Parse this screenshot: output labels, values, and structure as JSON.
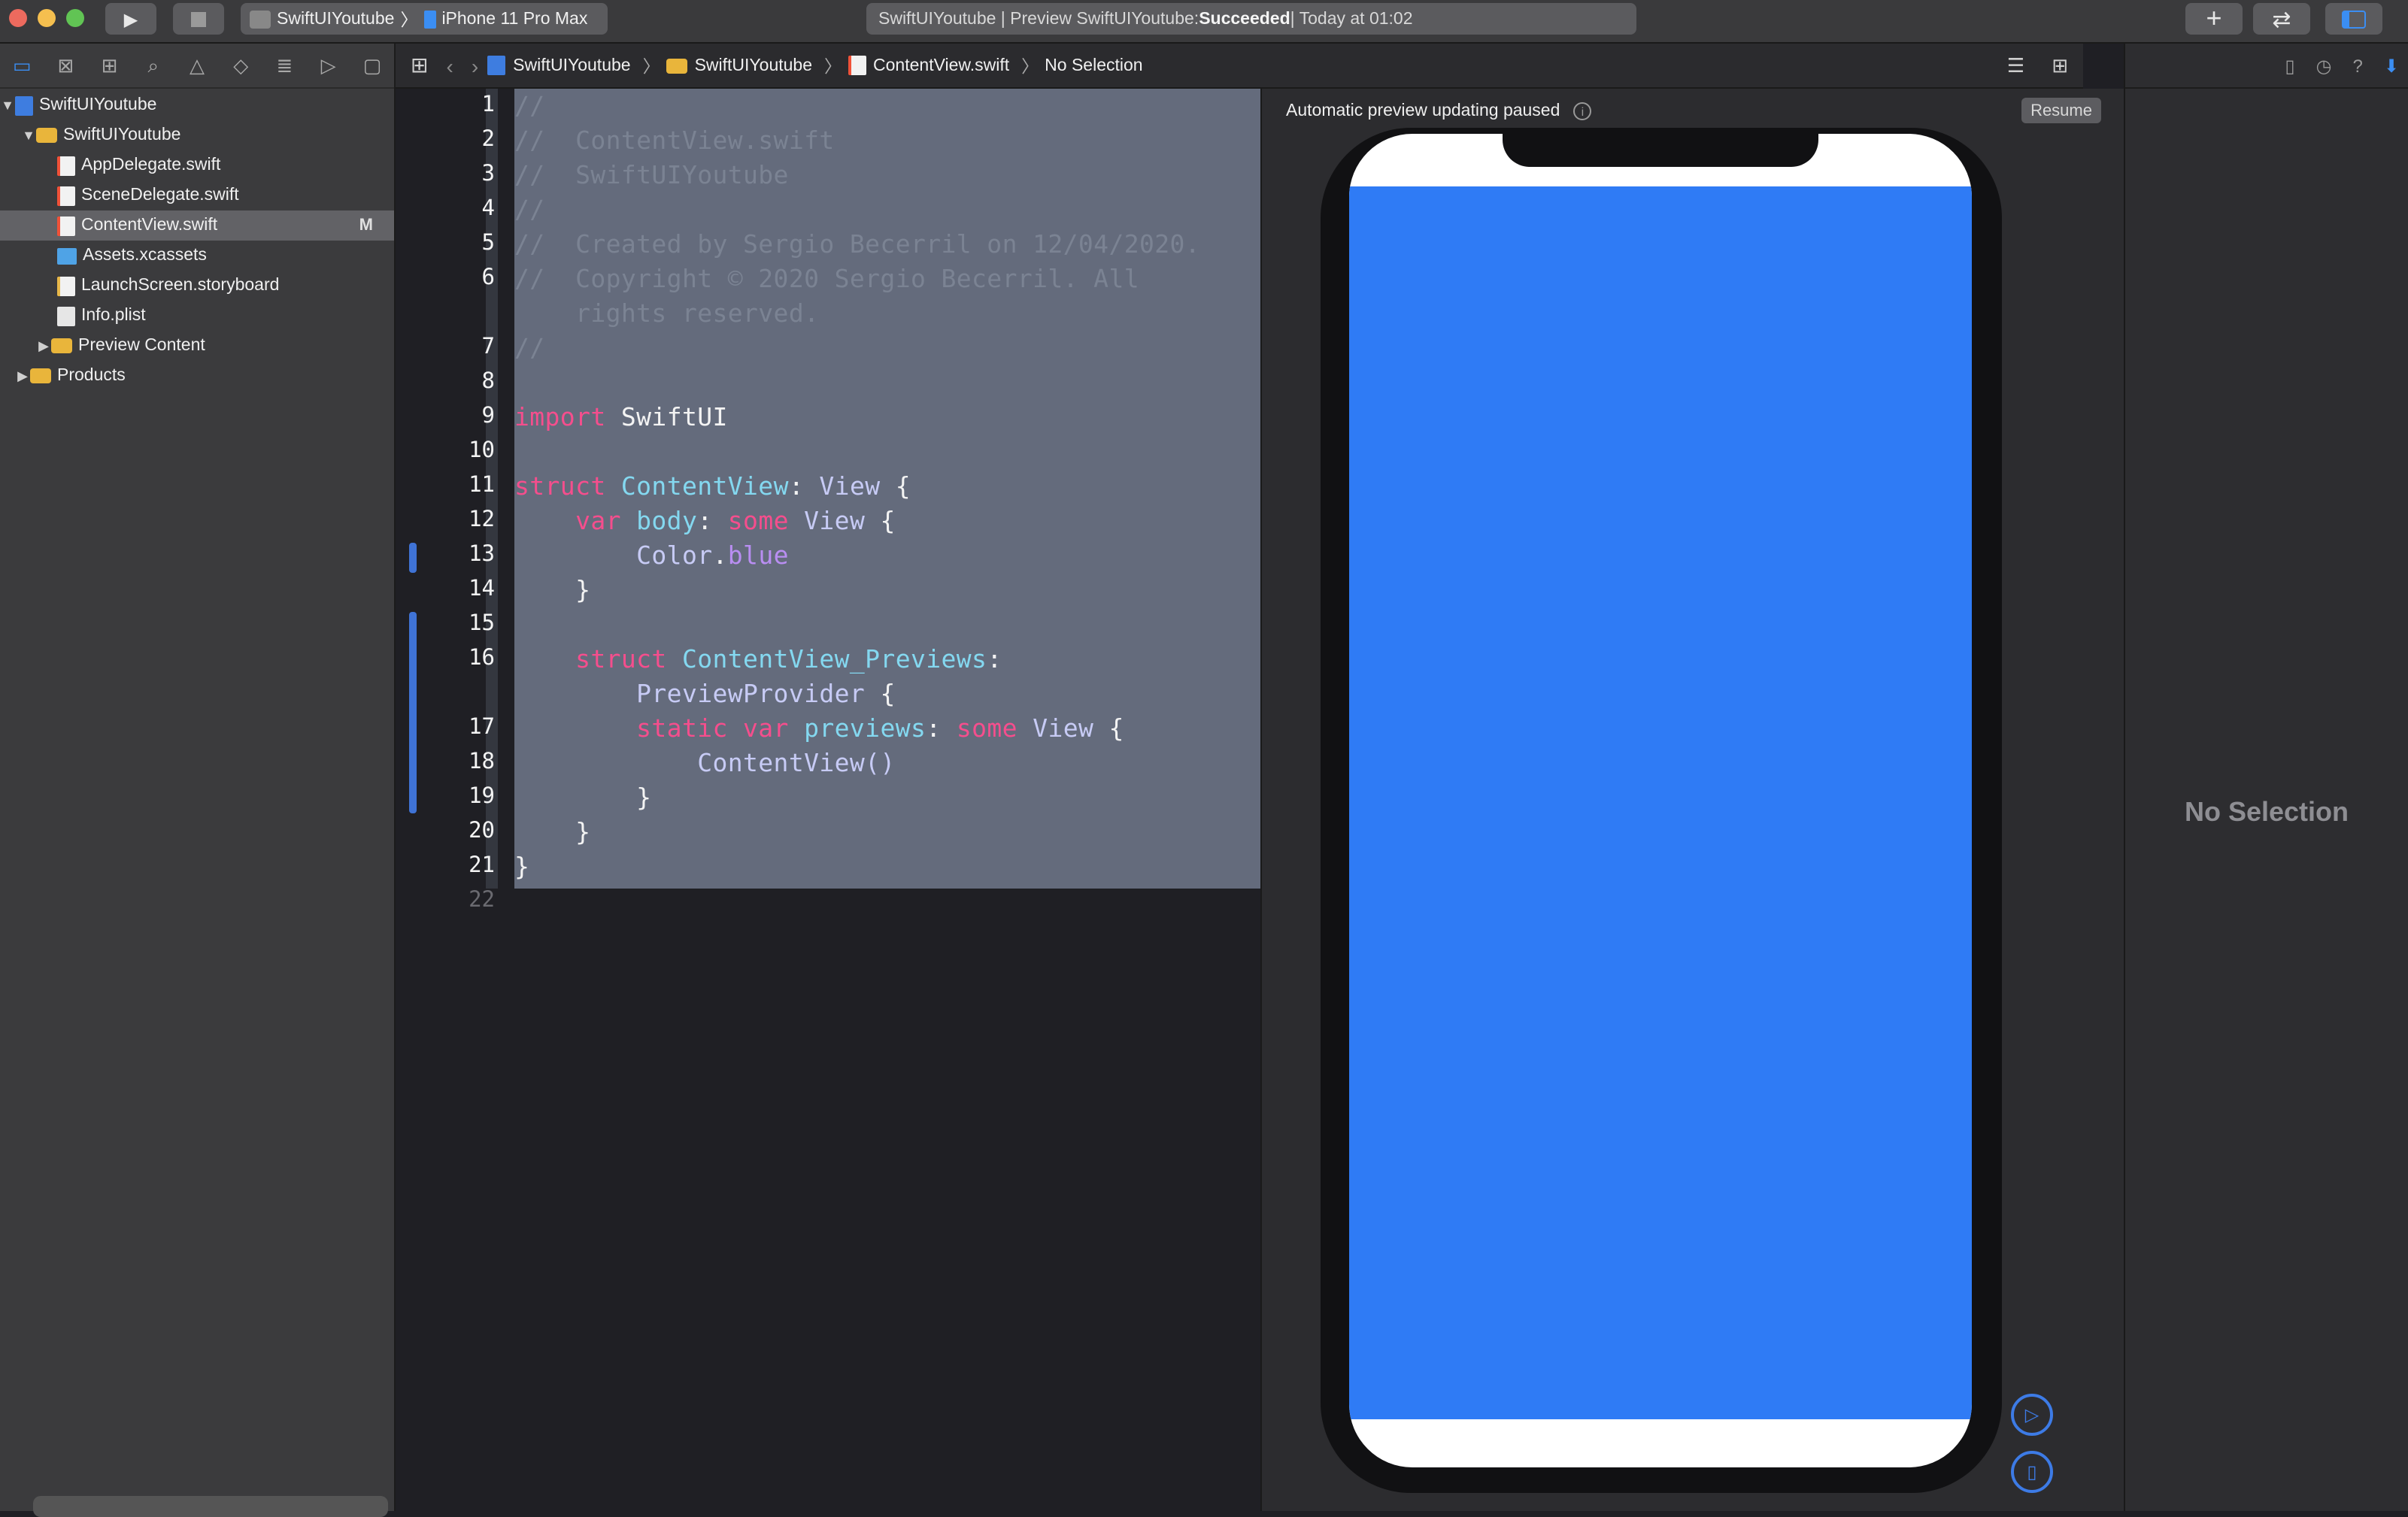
{
  "toolbar": {
    "scheme_target": "SwiftUIYoutube",
    "scheme_separator": "〉",
    "device": "iPhone 11 Pro Max",
    "activity_prefix": "SwiftUIYoutube | Preview SwiftUIYoutube: ",
    "activity_status": "Succeeded",
    "activity_time": " | Today at 01:02",
    "add_label": "+",
    "code_review_label": "⇄"
  },
  "navigator": {
    "items": [
      {
        "label": "SwiftUIYoutube",
        "icon": "project-icon"
      },
      {
        "label": "SwiftUIYoutube",
        "icon": "folder-icon"
      },
      {
        "label": "AppDelegate.swift",
        "icon": "swift-file-icon"
      },
      {
        "label": "SceneDelegate.swift",
        "icon": "swift-file-icon"
      },
      {
        "label": "ContentView.swift",
        "icon": "swift-file-icon",
        "status": "M"
      },
      {
        "label": "Assets.xcassets",
        "icon": "assets-folder-icon"
      },
      {
        "label": "LaunchScreen.storyboard",
        "icon": "storyboard-icon"
      },
      {
        "label": "Info.plist",
        "icon": "plist-icon"
      },
      {
        "label": "Preview Content",
        "icon": "folder-icon"
      },
      {
        "label": "Products",
        "icon": "folder-icon"
      }
    ]
  },
  "jumpbar": {
    "crumbs": [
      "SwiftUIYoutube",
      "SwiftUIYoutube",
      "ContentView.swift",
      "No Selection"
    ]
  },
  "editor": {
    "line_numbers": [
      "1",
      "2",
      "3",
      "4",
      "5",
      "6",
      "7",
      "8",
      "9",
      "10",
      "11",
      "12",
      "13",
      "14",
      "15",
      "16",
      "17",
      "18",
      "19",
      "20",
      "21",
      "22"
    ],
    "lines": {
      "l1": "//",
      "l2": "//  ContentView.swift",
      "l3": "//  SwiftUIYoutube",
      "l4": "//",
      "l5": "//  Created by Sergio Becerril on 12/04/2020.",
      "l6a": "//  Copyright © 2020 Sergio Becerril. All",
      "l6b": "    rights reserved.",
      "l7": "//",
      "import_kw": "import",
      "import_mod": " SwiftUI",
      "struct_kw": "struct",
      "content_view": " ContentView",
      "colon_view": ": ",
      "view_type": "View",
      "brace_open": " {",
      "var_kw": "    var",
      "body_prop": " body",
      "colon": ": ",
      "some_kw": "some",
      "view_type2": " View",
      "color_type": "        Color",
      "dot": ".",
      "blue_prop": "blue",
      "close4": "    }",
      "struct_kw2": "    struct",
      "previews_name": " ContentView_Previews",
      "colon2": ":",
      "preview_provider": "        PreviewProvider",
      "static_kw": "        static var",
      "previews_prop": " previews",
      "cv_call": "            ContentView()",
      "close8": "        }",
      "close0": "}"
    }
  },
  "canvas": {
    "status": "Automatic preview updating paused",
    "resume_label": "Resume"
  },
  "inspector": {
    "no_selection": "No Selection"
  },
  "colors": {
    "preview_blue": "#2f7bf5",
    "accent": "#3b8ef3",
    "selection": "#646b7c"
  }
}
